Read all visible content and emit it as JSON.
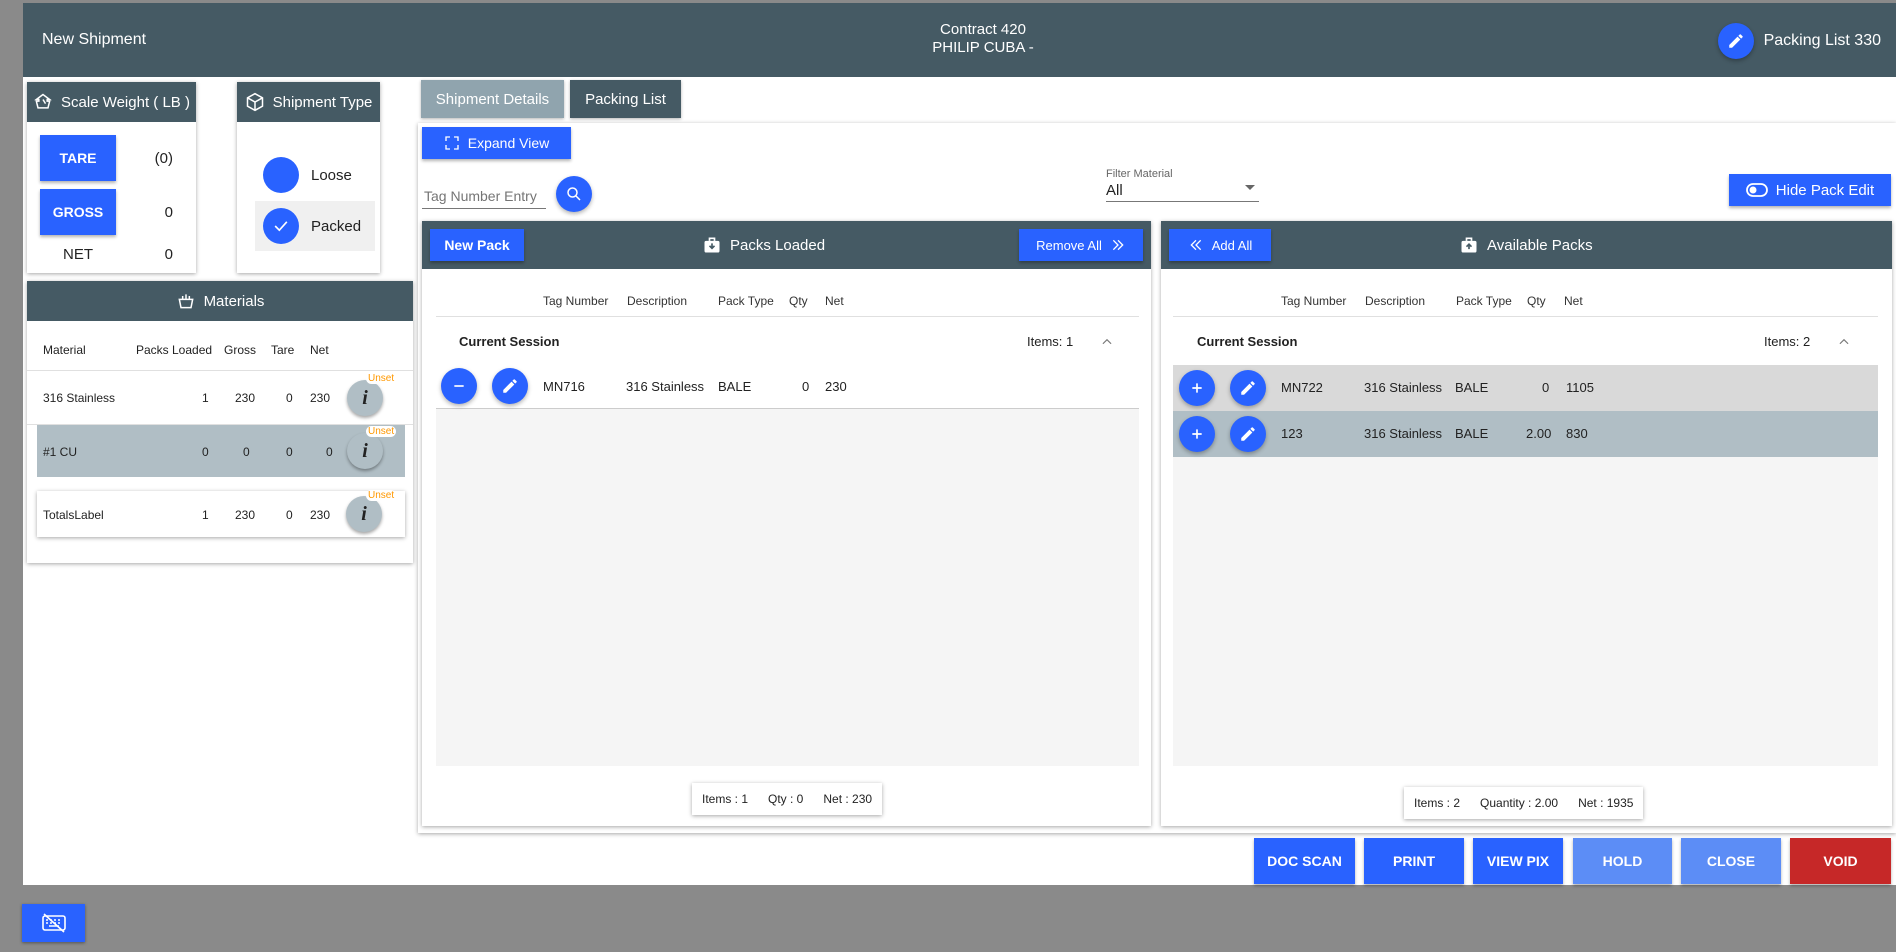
{
  "topbar": {
    "title": "New Shipment",
    "contract": "Contract 420",
    "customer": "PHILIP CUBA -",
    "packing_list": "Packing List 330"
  },
  "scale": {
    "title": "Scale Weight ( LB )",
    "tare_label": "TARE",
    "tare_value": "(0)",
    "gross_label": "GROSS",
    "gross_value": "0",
    "net_label": "NET",
    "net_value": "0"
  },
  "shipment_type": {
    "title": "Shipment Type",
    "options": [
      {
        "label": "Loose",
        "selected": false
      },
      {
        "label": "Packed",
        "selected": true
      }
    ]
  },
  "materials": {
    "title": "Materials",
    "columns": [
      "Material",
      "Packs Loaded",
      "Gross",
      "Tare",
      "Net"
    ],
    "rows": [
      {
        "material": "316 Stainless",
        "packs": "1",
        "gross": "230",
        "tare": "0",
        "net": "230",
        "badge": "Unset"
      },
      {
        "material": "#1 CU",
        "packs": "0",
        "gross": "0",
        "tare": "0",
        "net": "0",
        "badge": "Unset"
      }
    ],
    "totals": {
      "material": "TotalsLabel",
      "packs": "1",
      "gross": "230",
      "tare": "0",
      "net": "230",
      "badge": "Unset"
    }
  },
  "tabs": [
    {
      "label": "Shipment Details"
    },
    {
      "label": "Packing List"
    }
  ],
  "toolbar": {
    "expand_label": "Expand View",
    "tag_placeholder": "Tag Number Entry",
    "filter_label": "Filter Material",
    "filter_value": "All",
    "hide_pack_edit": "Hide Pack Edit"
  },
  "packs_loaded": {
    "new_pack": "New Pack",
    "title": "Packs Loaded",
    "remove_all": "Remove All",
    "columns": [
      "Tag Number",
      "Description",
      "Pack Type",
      "Qty",
      "Net"
    ],
    "session_label": "Current Session",
    "session_count": "Items: 1",
    "rows": [
      {
        "tag": "MN716",
        "desc": "316 Stainless",
        "type": "BALE",
        "qty": "0",
        "net": "230"
      }
    ],
    "summary": {
      "items": "Items : 1",
      "qty": "Qty : 0",
      "net": "Net : 230"
    }
  },
  "available_packs": {
    "add_all": "Add All",
    "title": "Available Packs",
    "columns": [
      "Tag Number",
      "Description",
      "Pack Type",
      "Qty",
      "Net"
    ],
    "session_label": "Current Session",
    "session_count": "Items: 2",
    "rows": [
      {
        "tag": "MN722",
        "desc": "316 Stainless",
        "type": "BALE",
        "qty": "0",
        "net": "1105"
      },
      {
        "tag": "123",
        "desc": "316 Stainless",
        "type": "BALE",
        "qty": "2.00",
        "net": "830"
      }
    ],
    "summary": {
      "items": "Items : 2",
      "qty": "Quantity : 2.00",
      "net": "Net : 1935"
    }
  },
  "actions": {
    "doc_scan": "DOC SCAN",
    "print": "PRINT",
    "view_pix": "VIEW PIX",
    "hold": "HOLD",
    "close": "CLOSE",
    "void": "VOID"
  },
  "colors": {
    "primary": "#2962ff",
    "header": "#455a64",
    "light_primary": "#5c8df6",
    "danger": "#c62828",
    "warning": "#ff9800"
  }
}
